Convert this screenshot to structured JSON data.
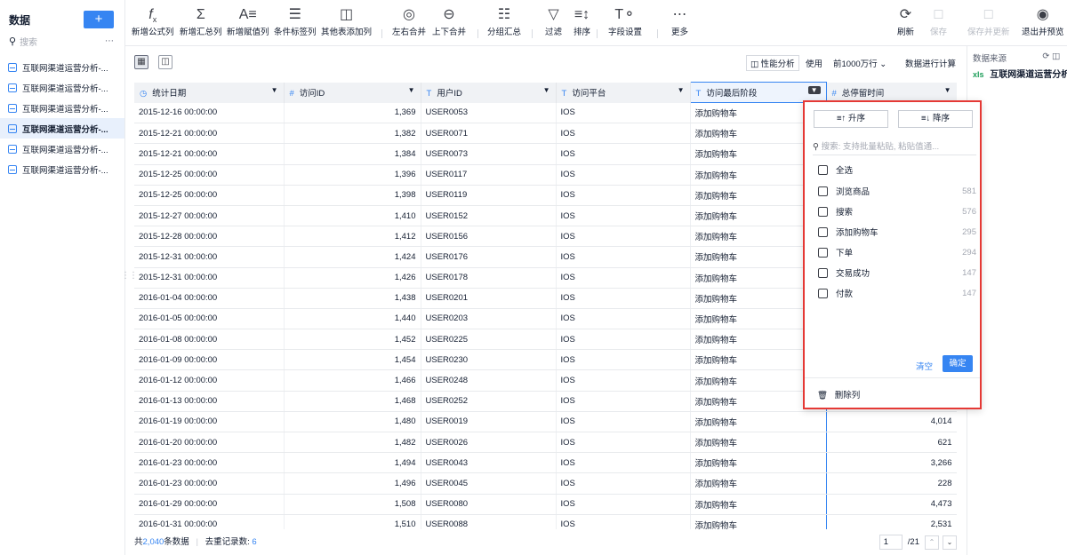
{
  "sidebar": {
    "title": "数据",
    "add_label": "+",
    "search_placeholder": "搜索",
    "items": [
      {
        "label": "互联网渠道运营分析-..."
      },
      {
        "label": "互联网渠道运营分析-..."
      },
      {
        "label": "互联网渠道运营分析-..."
      },
      {
        "label": "互联网渠道运营分析-..."
      },
      {
        "label": "互联网渠道运营分析-..."
      },
      {
        "label": "互联网渠道运营分析-..."
      }
    ]
  },
  "toolbar": {
    "formula": "新增公式列",
    "summary": "新增汇总列",
    "assign": "新增赋值列",
    "condition": "条件标签列",
    "other": "其他表添加列",
    "merge_lr": "左右合并",
    "merge_ud": "上下合并",
    "group": "分组汇总",
    "filter": "过滤",
    "sort": "排序",
    "field": "字段设置",
    "more": "更多",
    "refresh": "刷新",
    "save": "保存",
    "save_update": "保存并更新",
    "exit_preview": "退出并预览"
  },
  "subbar": {
    "perf": "性能分析",
    "use": "使用",
    "rows": "前1000万行",
    "calc": "数据进行计算"
  },
  "right_panel": {
    "title": "数据来源",
    "source_tag": "xls",
    "source_name": "互联网渠道运营分析"
  },
  "columns": [
    {
      "type": "◷",
      "name": "统计日期"
    },
    {
      "type": "#",
      "name": "访问ID"
    },
    {
      "type": "T",
      "name": "用户ID"
    },
    {
      "type": "T",
      "name": "访问平台"
    },
    {
      "type": "T",
      "name": "访问最后阶段"
    },
    {
      "type": "#",
      "name": "总停留时间"
    }
  ],
  "rows": [
    [
      "2015-12-16 00:00:00",
      "1,369",
      "USER0053",
      "IOS",
      "添加购物车",
      ""
    ],
    [
      "2015-12-21 00:00:00",
      "1,382",
      "USER0071",
      "IOS",
      "添加购物车",
      ""
    ],
    [
      "2015-12-21 00:00:00",
      "1,384",
      "USER0073",
      "IOS",
      "添加购物车",
      ""
    ],
    [
      "2015-12-25 00:00:00",
      "1,396",
      "USER0117",
      "IOS",
      "添加购物车",
      ""
    ],
    [
      "2015-12-25 00:00:00",
      "1,398",
      "USER0119",
      "IOS",
      "添加购物车",
      ""
    ],
    [
      "2015-12-27 00:00:00",
      "1,410",
      "USER0152",
      "IOS",
      "添加购物车",
      ""
    ],
    [
      "2015-12-28 00:00:00",
      "1,412",
      "USER0156",
      "IOS",
      "添加购物车",
      ""
    ],
    [
      "2015-12-31 00:00:00",
      "1,424",
      "USER0176",
      "IOS",
      "添加购物车",
      ""
    ],
    [
      "2015-12-31 00:00:00",
      "1,426",
      "USER0178",
      "IOS",
      "添加购物车",
      ""
    ],
    [
      "2016-01-04 00:00:00",
      "1,438",
      "USER0201",
      "IOS",
      "添加购物车",
      ""
    ],
    [
      "2016-01-05 00:00:00",
      "1,440",
      "USER0203",
      "IOS",
      "添加购物车",
      ""
    ],
    [
      "2016-01-08 00:00:00",
      "1,452",
      "USER0225",
      "IOS",
      "添加购物车",
      ""
    ],
    [
      "2016-01-09 00:00:00",
      "1,454",
      "USER0230",
      "IOS",
      "添加购物车",
      ""
    ],
    [
      "2016-01-12 00:00:00",
      "1,466",
      "USER0248",
      "IOS",
      "添加购物车",
      ""
    ],
    [
      "2016-01-13 00:00:00",
      "1,468",
      "USER0252",
      "IOS",
      "添加购物车",
      ""
    ],
    [
      "2016-01-19 00:00:00",
      "1,480",
      "USER0019",
      "IOS",
      "添加购物车",
      "4,014"
    ],
    [
      "2016-01-20 00:00:00",
      "1,482",
      "USER0026",
      "IOS",
      "添加购物车",
      "621"
    ],
    [
      "2016-01-23 00:00:00",
      "1,494",
      "USER0043",
      "IOS",
      "添加购物车",
      "3,266"
    ],
    [
      "2016-01-23 00:00:00",
      "1,496",
      "USER0045",
      "IOS",
      "添加购物车",
      "228"
    ],
    [
      "2016-01-29 00:00:00",
      "1,508",
      "USER0080",
      "IOS",
      "添加购物车",
      "4,473"
    ],
    [
      "2016-01-31 00:00:00",
      "1,510",
      "USER0088",
      "IOS",
      "添加购物车",
      "2,531"
    ]
  ],
  "footer": {
    "total_prefix": "共",
    "total_count": "2,040",
    "total_suffix": "条数据",
    "dedup_label": "去重记录数:",
    "dedup_count": "6",
    "page": "1",
    "page_total": "/21"
  },
  "popup": {
    "asc": "升序",
    "desc": "降序",
    "search_placeholder": "搜索: 支持批量粘贴, 粘贴值通...",
    "select_all": "全选",
    "options": [
      {
        "label": "浏览商品",
        "count": "581"
      },
      {
        "label": "搜索",
        "count": "576"
      },
      {
        "label": "添加购物车",
        "count": "295"
      },
      {
        "label": "下单",
        "count": "294"
      },
      {
        "label": "交易成功",
        "count": "147"
      },
      {
        "label": "付款",
        "count": "147"
      }
    ],
    "clear": "清空",
    "ok": "确定",
    "delete_col": "删除列"
  },
  "colors": {
    "accent": "#3685f2",
    "highlight_border": "#e53935"
  }
}
